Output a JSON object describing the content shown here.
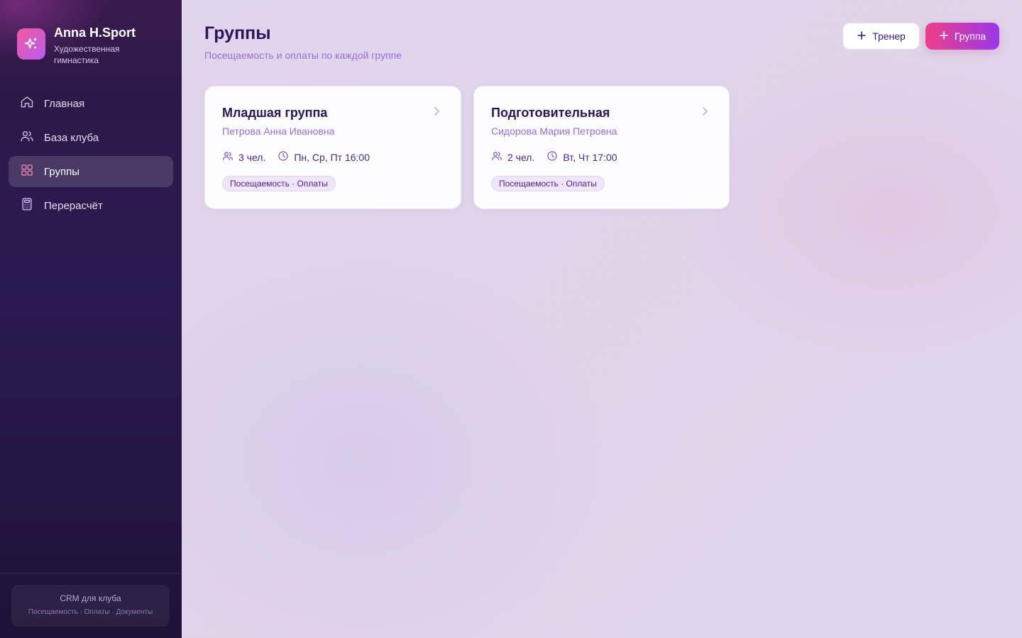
{
  "brand": {
    "title": "Anna H.Sport",
    "subtitle": "Художественная гимнастика",
    "logo_icon": "sparkles-icon"
  },
  "nav": {
    "items": [
      {
        "label": "Главная",
        "icon": "home-icon"
      },
      {
        "label": "База клуба",
        "icon": "users-icon"
      },
      {
        "label": "Группы",
        "icon": "grid-icon",
        "active": true
      },
      {
        "label": "Перерасчёт",
        "icon": "calculator-icon"
      }
    ]
  },
  "footer": {
    "title": "CRM для клуба",
    "subtitle": "Посещаемость · Оплаты · Документы"
  },
  "header": {
    "title": "Группы",
    "subtitle": "Посещаемость и оплаты по каждой группе",
    "trainer_button": "Тренер",
    "group_button": "Группа"
  },
  "groups": [
    {
      "name": "Младшая группа",
      "trainer": "Петрова Анна Ивановна",
      "members": "3 чел.",
      "schedule": "Пн, Ср, Пт 16:00",
      "badge": "Посещаемость · Оплаты"
    },
    {
      "name": "Подготовительная",
      "trainer": "Сидорова Мария Петровна",
      "members": "2 чел.",
      "schedule": "Вт, Чт 17:00",
      "badge": "Посещаемость · Оплаты"
    }
  ],
  "colors": {
    "accent_pink": "#ec3f8c",
    "accent_purple": "#9a38e8",
    "title": "#2a1658",
    "sidebar": "#2a1a52"
  }
}
